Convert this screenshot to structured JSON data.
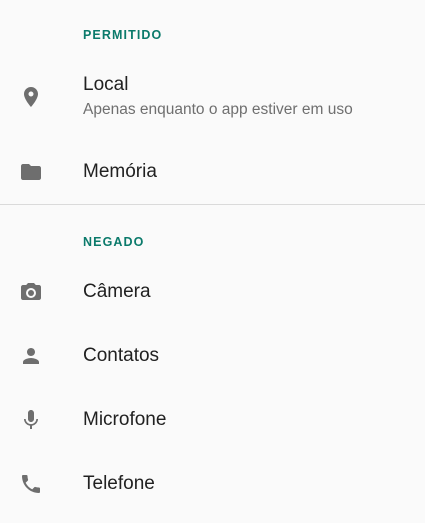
{
  "sections": {
    "allowed": {
      "header": "PERMITIDO"
    },
    "denied": {
      "header": "NEGADO"
    }
  },
  "permissions": {
    "location": {
      "title": "Local",
      "subtitle": "Apenas enquanto o app estiver em uso",
      "icon": "location-pin-icon"
    },
    "storage": {
      "title": "Memória",
      "icon": "folder-icon"
    },
    "camera": {
      "title": "Câmera",
      "icon": "camera-icon"
    },
    "contacts": {
      "title": "Contatos",
      "icon": "person-icon"
    },
    "microphone": {
      "title": "Microfone",
      "icon": "microphone-icon"
    },
    "phone": {
      "title": "Telefone",
      "icon": "phone-icon"
    }
  },
  "colors": {
    "accent": "#0b7a6b",
    "icon": "#6e6e6e",
    "background": "#fafafa",
    "divider": "#dadada"
  }
}
